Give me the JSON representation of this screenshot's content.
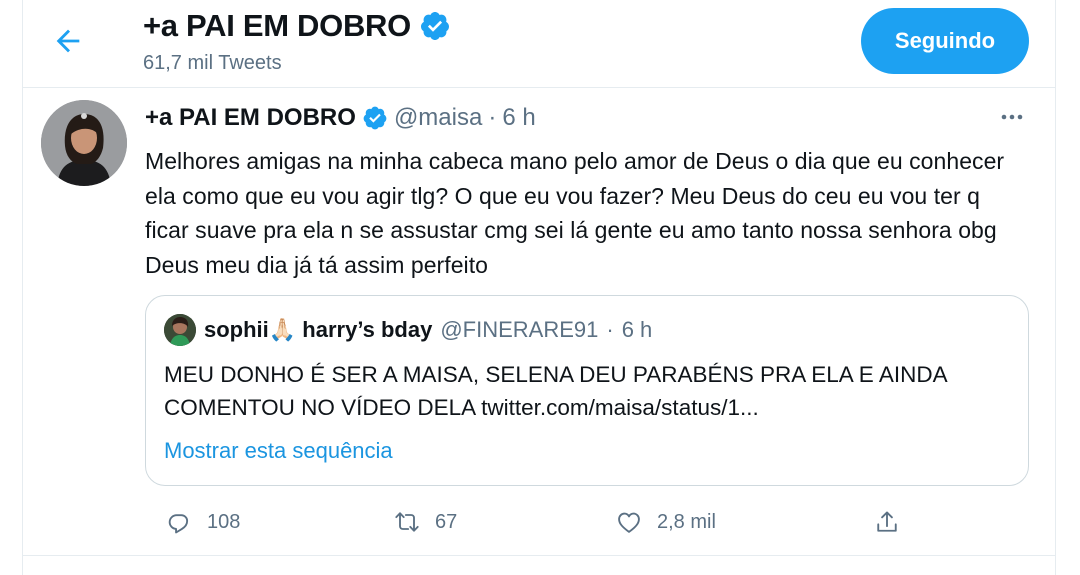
{
  "header": {
    "title": "+a PAI EM DOBRO",
    "subtitle": "61,7 mil Tweets",
    "follow_button": "Seguindo"
  },
  "tweet": {
    "name": "+a PAI EM DOBRO",
    "handle": "@maisa",
    "dot": "·",
    "time": "6 h",
    "text": "Melhores amigas na minha cabeca mano pelo amor de Deus o dia que eu conhecer ela como que eu vou agir tlg? O que eu vou fazer? Meu Deus do ceu eu vou ter q ficar suave pra ela n se assustar cmg sei lá gente eu amo tanto nossa senhora obg Deus meu dia já tá assim perfeito",
    "quote": {
      "name": "sophii🙏🏻 harry’s bday",
      "handle": "@FINERARE91",
      "dot": "·",
      "time": "6 h",
      "text": "MEU DONHO É SER A MAISA, SELENA DEU PARABÉNS PRA ELA E AINDA COMENTOU NO VÍDEO DELA twitter.com/maisa/status/1...",
      "show_thread": "Mostrar esta sequência"
    },
    "actions": {
      "replies": "108",
      "retweets": "67",
      "likes": "2,8 mil"
    }
  },
  "colors": {
    "accent": "#1da1f2",
    "secondary_text": "#5b7083",
    "border": "#e6ecf0"
  },
  "icons": [
    "back-arrow-icon",
    "verified-badge-icon",
    "more-icon",
    "reply-icon",
    "retweet-icon",
    "like-icon",
    "share-icon"
  ]
}
